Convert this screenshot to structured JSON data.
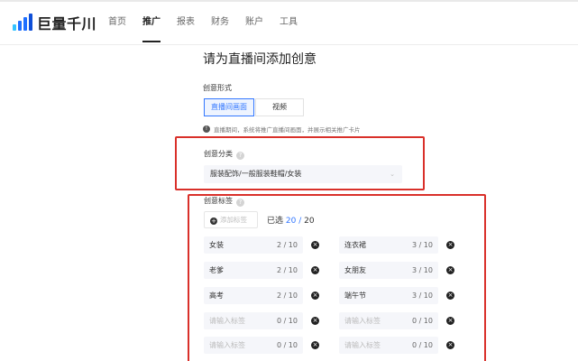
{
  "header": {
    "logo_text": "巨量千川",
    "nav": [
      "首页",
      "推广",
      "报表",
      "财务",
      "账户",
      "工具"
    ],
    "active_nav": "推广"
  },
  "page": {
    "title": "请为直播间添加创意"
  },
  "creative_form": {
    "label": "创意形式",
    "options": [
      "直播间画面",
      "视频"
    ],
    "selected": "直播间画面",
    "hint": "直播期间，系统将推广直播间画面，并展示相关推广卡片"
  },
  "creative_category": {
    "label": "创意分类",
    "value": "服装配饰/一般服装鞋帽/女装"
  },
  "creative_tags": {
    "label": "创意标签",
    "add_placeholder": "添加标签",
    "count_prefix": "已选",
    "selected_count": "20",
    "count_sep": "/",
    "max_count": "20",
    "tags": [
      {
        "text": "女装",
        "count": "2 / 10",
        "filled": true
      },
      {
        "text": "连衣裙",
        "count": "3 / 10",
        "filled": true
      },
      {
        "text": "老爹",
        "count": "2 / 10",
        "filled": true
      },
      {
        "text": "女朋友",
        "count": "3 / 10",
        "filled": true
      },
      {
        "text": "高考",
        "count": "2 / 10",
        "filled": true
      },
      {
        "text": "端午节",
        "count": "3 / 10",
        "filled": true
      },
      {
        "text": "请输入标签",
        "count": "0 / 10",
        "filled": false
      },
      {
        "text": "请输入标签",
        "count": "0 / 10",
        "filled": false
      },
      {
        "text": "请输入标签",
        "count": "0 / 10",
        "filled": false
      },
      {
        "text": "请输入标签",
        "count": "0 / 10",
        "filled": false
      }
    ]
  },
  "icons": {
    "help": "question-circle-icon",
    "info": "info-circle-icon",
    "delete": "close-circle-icon",
    "add": "plus-circle-icon",
    "caret": "chevron-down-icon"
  },
  "colors": {
    "accent": "#3377ff",
    "highlight_box": "#d9302a"
  }
}
